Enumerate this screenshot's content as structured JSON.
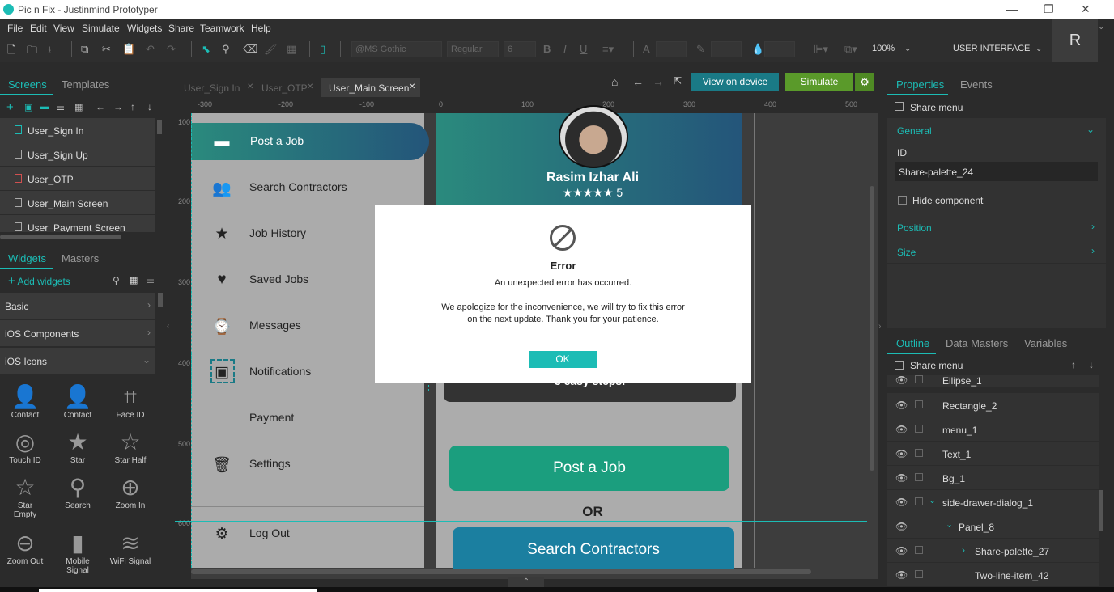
{
  "window": {
    "title": "Pic n Fix - Justinmind Prototyper",
    "minimize": "—",
    "restore": "❐",
    "close": "✕"
  },
  "menu": [
    "File",
    "Edit",
    "View",
    "Simulate",
    "Widgets",
    "Share",
    "Teamwork",
    "Help"
  ],
  "toolbar": {
    "font_family": "@MS Gothic",
    "font_style": "Regular",
    "font_size": "6",
    "bold": "B",
    "italic": "I",
    "underline": "U",
    "zoom": "100%",
    "mode": "USER INTERFACE",
    "user_initial": "R"
  },
  "left_panel": {
    "tabs": [
      "Screens",
      "Templates"
    ],
    "screens": [
      "User_Sign In",
      "User_Sign Up",
      "User_OTP",
      "User_Main Screen",
      "User_Payment Screen"
    ],
    "widget_tabs": [
      "Widgets",
      "Masters"
    ],
    "add_widgets": "Add widgets",
    "categories": [
      "Basic",
      "iOS Components",
      "iOS Icons"
    ],
    "widgets": [
      {
        "label": "Contact",
        "icon": "contact-icon",
        "glyph": "👤"
      },
      {
        "label": "Contact",
        "icon": "contact-outline-icon",
        "glyph": "👤"
      },
      {
        "label": "Face ID",
        "icon": "face-id-icon",
        "glyph": "⌗"
      },
      {
        "label": "Touch ID",
        "icon": "touch-id-icon",
        "glyph": "◎"
      },
      {
        "label": "Star",
        "icon": "star-icon",
        "glyph": "★"
      },
      {
        "label": "Star Half",
        "icon": "star-half-icon",
        "glyph": "☆"
      },
      {
        "label": "Star Empty",
        "icon": "star-empty-icon",
        "glyph": "☆"
      },
      {
        "label": "Search",
        "icon": "search-icon",
        "glyph": "⚲"
      },
      {
        "label": "Zoom In",
        "icon": "zoom-in-icon",
        "glyph": "⊕"
      },
      {
        "label": "Zoom Out",
        "icon": "zoom-out-icon",
        "glyph": "⊖"
      },
      {
        "label": "Mobile Signal",
        "icon": "mobile-signal-icon",
        "glyph": "▮"
      },
      {
        "label": "WiFi Signal",
        "icon": "wifi-signal-icon",
        "glyph": "≋"
      }
    ]
  },
  "editor": {
    "tabs": [
      "User_Sign In",
      "User_OTP",
      "User_Main Screen"
    ],
    "active_tab": "User_Main Screen",
    "view_on_device": "View on device",
    "simulate": "Simulate",
    "ruler_top": [
      "-300",
      "-200",
      "-100",
      "0",
      "100",
      "200",
      "300",
      "400",
      "500"
    ],
    "ruler_left": [
      "100",
      "200",
      "300",
      "400",
      "500",
      "600"
    ]
  },
  "canvas": {
    "drawer_items": [
      {
        "label": "Post a Job",
        "icon": "folder-icon",
        "glyph": "▬"
      },
      {
        "label": "Search Contractors",
        "icon": "people-icon",
        "glyph": "👥"
      },
      {
        "label": "Job History",
        "icon": "star-icon",
        "glyph": "★"
      },
      {
        "label": "Saved Jobs",
        "icon": "heart-icon",
        "glyph": "♥"
      },
      {
        "label": "Messages",
        "icon": "messages-icon",
        "glyph": "⌚"
      },
      {
        "label": "Notifications",
        "icon": "notifications-icon",
        "glyph": "▣"
      },
      {
        "label": "Payment",
        "icon": "",
        "glyph": ""
      },
      {
        "label": "Settings",
        "icon": "trash-icon",
        "glyph": "🗑"
      },
      {
        "label": "Log Out",
        "icon": "gear-icon",
        "glyph": "⚙"
      }
    ],
    "profile_name": "Rasim Izhar Ali",
    "rating": "★★★★★ 5",
    "steps_text": "3 easy steps.",
    "post_job_button": "Post a Job",
    "or_text": "OR",
    "search_contractors_button": "Search Contractors"
  },
  "dialog": {
    "title": "Error",
    "line1": "An unexpected error has occurred.",
    "line2": "We apologize for the inconvenience, we will try to fix this error",
    "line3": "on the next update. Thank you for your patience.",
    "ok": "OK"
  },
  "right_panel": {
    "tabs": [
      "Properties",
      "Events"
    ],
    "selected": "Share menu",
    "general": "General",
    "id_label": "ID",
    "id_value": "Share-palette_24",
    "hide_component": "Hide component",
    "position": "Position",
    "size": "Size",
    "outline_tabs": [
      "Outline",
      "Data Masters",
      "Variables"
    ],
    "outline_header": "Share menu",
    "outline": [
      {
        "label": "Ellipse_1",
        "indent": 0
      },
      {
        "label": "Rectangle_2",
        "indent": 0
      },
      {
        "label": "menu_1",
        "indent": 0
      },
      {
        "label": "Text_1",
        "indent": 0
      },
      {
        "label": "Bg_1",
        "indent": 0
      },
      {
        "label": "side-drawer-dialog_1",
        "indent": 0
      },
      {
        "label": "Panel_8",
        "indent": 1
      },
      {
        "label": "Share-palette_27",
        "indent": 2
      },
      {
        "label": "Two-line-item_42",
        "indent": 2
      }
    ]
  },
  "colors": {
    "accent": "#1cbcb5",
    "simulate": "#5a9a2a",
    "view_on_device": "#1a7a86",
    "post_job": "#1b9e7e",
    "search_contractors": "#1b7fa0"
  }
}
